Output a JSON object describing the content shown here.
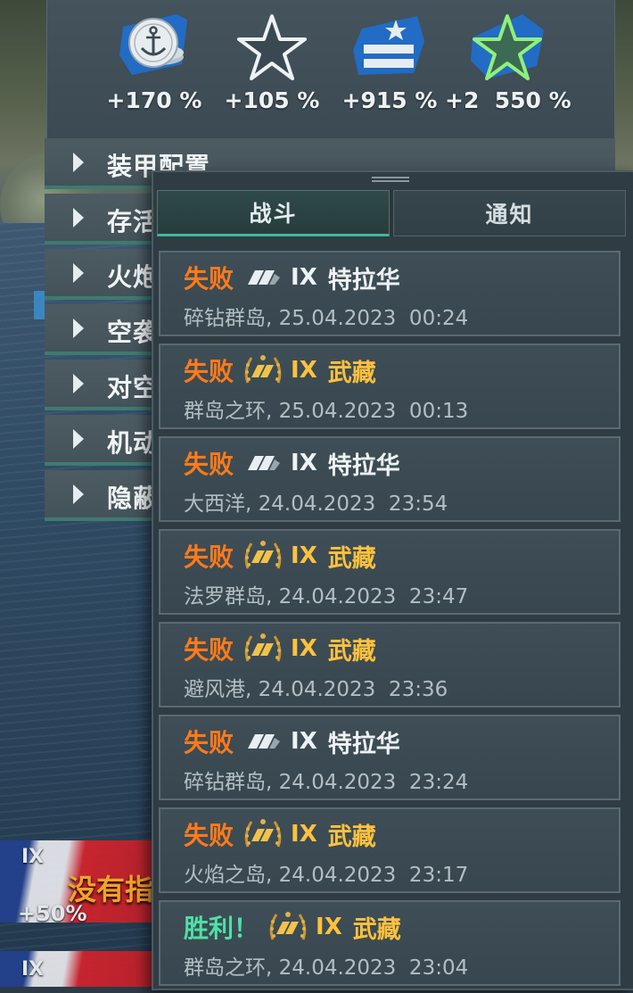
{
  "bonuses": [
    {
      "value": "+170 %",
      "icon": "anchor-coin-icon"
    },
    {
      "value": "+105 %",
      "icon": "star-outline-icon"
    },
    {
      "value": "+915 %",
      "icon": "rank-chevron-icon"
    },
    {
      "value": "+2  550 %",
      "icon": "green-star-icon"
    }
  ],
  "categories": [
    {
      "label": "装甲配置"
    },
    {
      "label": "存活"
    },
    {
      "label": "火炮"
    },
    {
      "label": "空袭"
    },
    {
      "label": "对空"
    },
    {
      "label": "机动"
    },
    {
      "label": "隐蔽"
    }
  ],
  "background": {
    "tier1": "IX",
    "bonus1": "+50%",
    "notice": "没有指",
    "tier2": "IX"
  },
  "tabs": [
    {
      "label": "战斗"
    },
    {
      "label": "通知"
    }
  ],
  "battles": [
    {
      "result": "失败",
      "type": "lose",
      "tier": "IX",
      "ship": "特拉华",
      "premium": false,
      "location": "碎钻群岛,",
      "datetime": "25.04.2023  00:24"
    },
    {
      "result": "失败",
      "type": "lose",
      "tier": "IX",
      "ship": "武藏",
      "premium": true,
      "location": "群岛之环,",
      "datetime": "25.04.2023  00:13"
    },
    {
      "result": "失败",
      "type": "lose",
      "tier": "IX",
      "ship": "特拉华",
      "premium": false,
      "location": "大西洋,",
      "datetime": "24.04.2023  23:54"
    },
    {
      "result": "失败",
      "type": "lose",
      "tier": "IX",
      "ship": "武藏",
      "premium": true,
      "location": "法罗群岛,",
      "datetime": "24.04.2023  23:47"
    },
    {
      "result": "失败",
      "type": "lose",
      "tier": "IX",
      "ship": "武藏",
      "premium": true,
      "location": "避风港,",
      "datetime": "24.04.2023  23:36"
    },
    {
      "result": "失败",
      "type": "lose",
      "tier": "IX",
      "ship": "特拉华",
      "premium": false,
      "location": "碎钻群岛,",
      "datetime": "24.04.2023  23:24"
    },
    {
      "result": "失败",
      "type": "lose",
      "tier": "IX",
      "ship": "武藏",
      "premium": true,
      "location": "火焰之岛,",
      "datetime": "24.04.2023  23:17"
    },
    {
      "result": "胜利！",
      "type": "win",
      "tier": "IX",
      "ship": "武藏",
      "premium": true,
      "location": "群岛之环,",
      "datetime": "24.04.2023  23:04"
    }
  ],
  "colors": {
    "lose": "#ff7a1a",
    "win": "#4fe0a6",
    "premium_gold": "#ffc13d",
    "accent_teal": "#3fb79a"
  }
}
